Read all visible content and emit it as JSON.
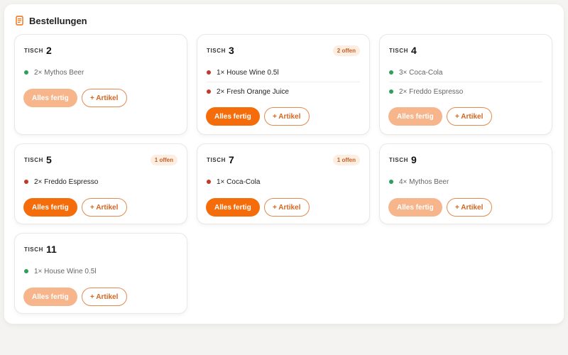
{
  "panel": {
    "title": "Bestellungen"
  },
  "labels": {
    "tisch": "TISCH",
    "done": "Alles fertig",
    "add": "+ Artikel"
  },
  "colors": {
    "accent": "#f46d0a",
    "accent_disabled": "#f7b58b",
    "status_open": "#c0392b",
    "status_done": "#2e9e5b"
  },
  "cards": [
    {
      "table": "2",
      "badge": "",
      "items": [
        {
          "text": "2× Mythos Beer",
          "status": "done"
        }
      ]
    },
    {
      "table": "3",
      "badge": "2 offen",
      "items": [
        {
          "text": "1× House Wine 0.5l",
          "status": "open"
        },
        {
          "text": "2× Fresh Orange Juice",
          "status": "open"
        }
      ]
    },
    {
      "table": "4",
      "badge": "",
      "items": [
        {
          "text": "3× Coca-Cola",
          "status": "done"
        },
        {
          "text": "2× Freddo Espresso",
          "status": "done"
        }
      ]
    },
    {
      "table": "5",
      "badge": "1 offen",
      "items": [
        {
          "text": "2× Freddo Espresso",
          "status": "open"
        }
      ]
    },
    {
      "table": "7",
      "badge": "1 offen",
      "items": [
        {
          "text": "1× Coca-Cola",
          "status": "open"
        }
      ]
    },
    {
      "table": "9",
      "badge": "",
      "items": [
        {
          "text": "4× Mythos Beer",
          "status": "done"
        }
      ]
    },
    {
      "table": "11",
      "badge": "",
      "items": [
        {
          "text": "1× House Wine 0.5l",
          "status": "done"
        }
      ]
    }
  ]
}
